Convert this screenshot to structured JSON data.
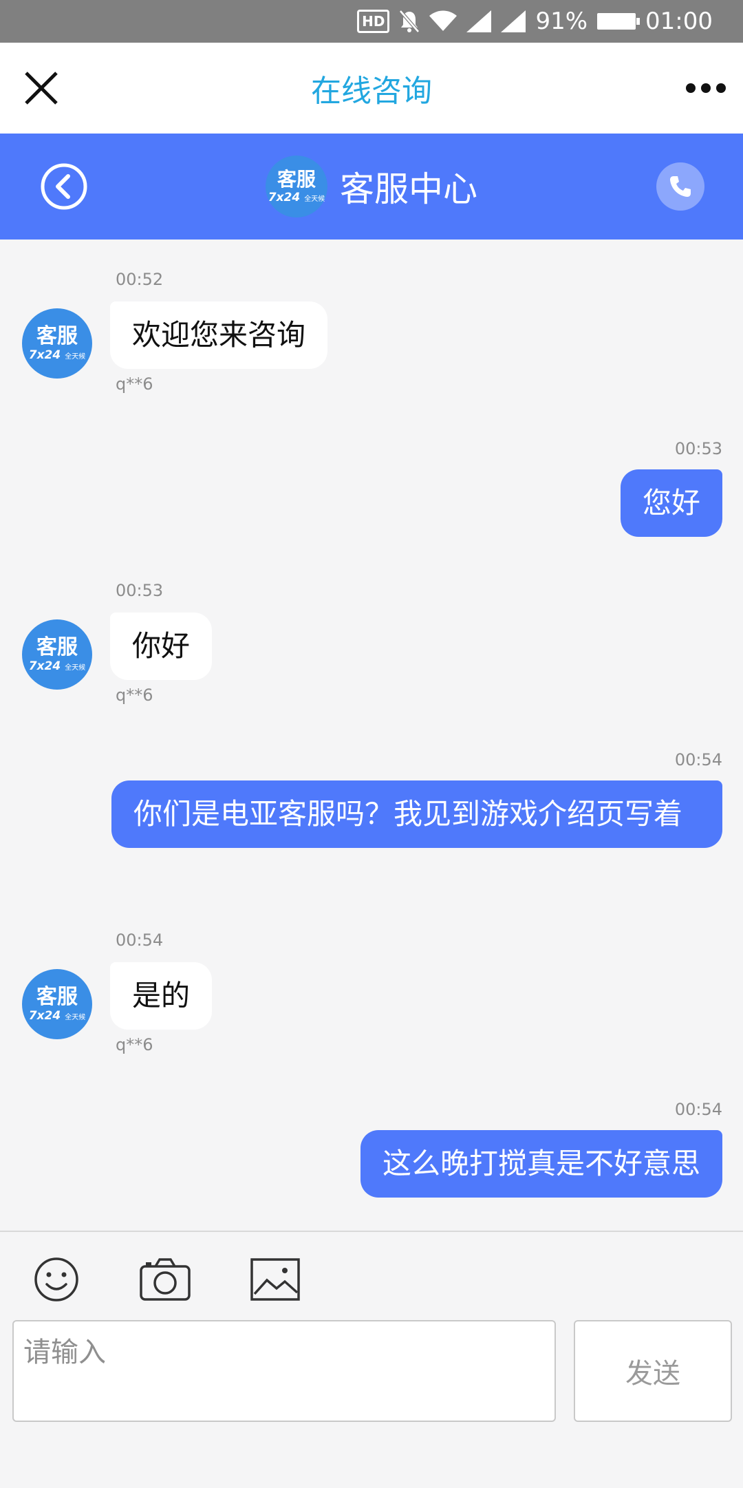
{
  "status_bar": {
    "hd": "HD",
    "battery": "91%",
    "time": "01:00",
    "icons": [
      "hd-icon",
      "mute-bell-icon",
      "wifi-icon",
      "signal-icon",
      "signal-icon",
      "battery-icon"
    ]
  },
  "top_nav": {
    "title": "在线咨询",
    "close_icon": "close-icon",
    "more_icon": "more-icon"
  },
  "header": {
    "name": "客服中心",
    "avatar": {
      "top": "客服",
      "num": "7x24",
      "sub": "全天候"
    },
    "back_icon": "back-circle-icon",
    "phone_icon": "phone-icon"
  },
  "messages": [
    {
      "dir": "in",
      "time": "00:52",
      "text": "欢迎您来咨询",
      "sender": "q**6"
    },
    {
      "dir": "out",
      "time": "00:53",
      "text": "您好"
    },
    {
      "dir": "in",
      "time": "00:53",
      "text": "你好",
      "sender": "q**6"
    },
    {
      "dir": "out",
      "time": "00:54",
      "text": "你们是电亚客服吗？我见到游戏介绍页写着"
    },
    {
      "dir": "in",
      "time": "00:54",
      "text": "是的",
      "sender": "q**6"
    },
    {
      "dir": "out",
      "time": "00:54",
      "text": "这么晚打搅真是不好意思"
    }
  ],
  "composer": {
    "placeholder": "请输入",
    "send_label": "发送",
    "tools": [
      "emoji-icon",
      "camera-icon",
      "image-icon"
    ]
  },
  "colors": {
    "accent_blue": "#4f79fb",
    "title_blue": "#22a7e0",
    "avatar_blue": "#3a8ee6",
    "status_bar": "#808080"
  }
}
